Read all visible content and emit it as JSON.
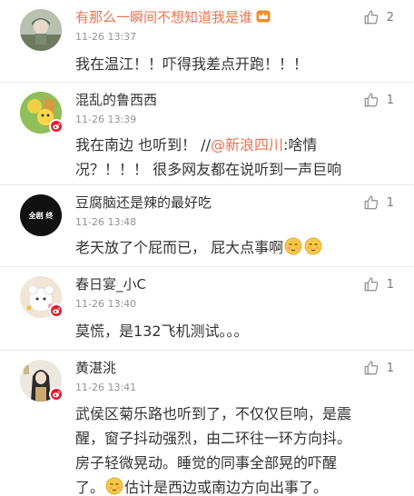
{
  "comments": [
    {
      "username": "有那么一瞬间不想知道我是谁",
      "time": "11-26 13:37",
      "likes": "2",
      "text": "我在温江！！吓得我差点开跑！！！"
    },
    {
      "username": "混乱的鲁西西",
      "time": "11-26 13:39",
      "likes": "1",
      "text_line1_a": "我在南边 也听到！ //",
      "mention": "@新浪四川",
      "text_line1_b": ":啥情",
      "text_line2": "况？！！！ 很多网友都在说听到一声巨响"
    },
    {
      "username": "豆腐脑还是辣的最好吃",
      "time": "11-26 13:48",
      "likes": "1",
      "avatar_text": "全剧 终",
      "text": "老天放了个屁而已，  屁大点事啊"
    },
    {
      "username": "春日宴_小C",
      "time": "11-26 13:40",
      "likes": "1",
      "text": "莫慌，是132飞机测试。。。"
    },
    {
      "username": "黄湛洮",
      "time": "11-26 13:41",
      "likes": "1",
      "text_line1": "武侯区菊乐路也听到了，不仅仅巨响，是震",
      "text_line2": "醒，窗子抖动强烈，由二环往一环方向抖。",
      "text_line3": "房子轻微晃动。睡觉的同事全部晃的吓醒",
      "text_line4": "了。",
      "text_line4_b": "估计是西边或南边方向出事了。"
    }
  ],
  "colors": {
    "accent": "#eb7350",
    "badge": "#e6162d",
    "time": "#939393"
  }
}
